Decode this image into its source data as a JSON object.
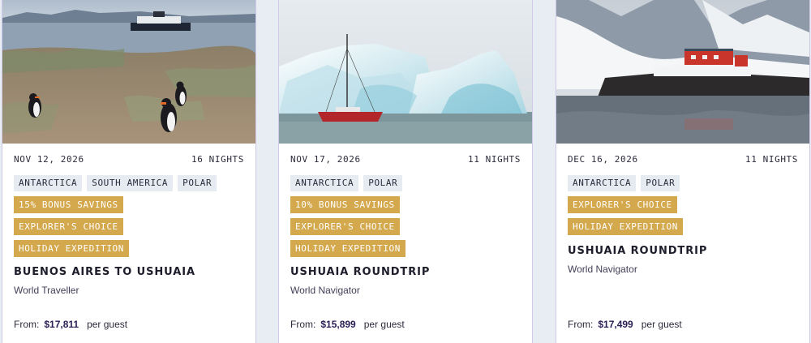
{
  "cards": [
    {
      "date": "NOV 12, 2026",
      "nights": "16 NIGHTS",
      "tags": [
        "ANTARCTICA",
        "SOUTH AMERICA",
        "POLAR"
      ],
      "badges": [
        "15% BONUS SAVINGS",
        "EXPLORER'S CHOICE",
        "HOLIDAY EXPEDITION"
      ],
      "title": "BUENOS AIRES TO USHUAIA",
      "ship": "World Traveller",
      "from_label": "From:",
      "price": "$17,811",
      "per_guest": "per guest"
    },
    {
      "date": "NOV 17, 2026",
      "nights": "11 NIGHTS",
      "tags": [
        "ANTARCTICA",
        "POLAR"
      ],
      "badges": [
        "10% BONUS SAVINGS",
        "EXPLORER'S CHOICE",
        "HOLIDAY EXPEDITION"
      ],
      "title": "USHUAIA ROUNDTRIP",
      "ship": "World Navigator",
      "from_label": "From:",
      "price": "$15,899",
      "per_guest": "per guest"
    },
    {
      "date": "DEC 16, 2026",
      "nights": "11 NIGHTS",
      "tags": [
        "ANTARCTICA",
        "POLAR"
      ],
      "badges": [
        "EXPLORER'S CHOICE",
        "HOLIDAY EXPEDITION"
      ],
      "title": "USHUAIA ROUNDTRIP",
      "ship": "World Navigator",
      "from_label": "From:",
      "price": "$17,499",
      "per_guest": "per guest"
    }
  ],
  "colors": {
    "page_background": "#e8ecf3",
    "tag_background": "#e6eaf1",
    "badge_background": "#d4a84d",
    "price_color": "#2a1d55",
    "card_border": "#cfc8e6"
  }
}
